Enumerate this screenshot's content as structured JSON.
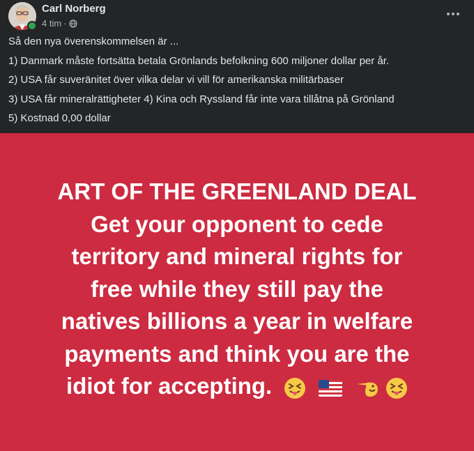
{
  "post": {
    "author": "Carl Norberg",
    "time": "4 tim",
    "separator": "·",
    "privacy_icon": "globe-icon",
    "more_icon": "more-options-icon",
    "text_lines": [
      "Så den nya överenskommelsen är ...",
      "1) Danmark måste fortsätta betala Grönlands befolkning 600 miljoner dollar per år.",
      "2) USA får suveränitet över vilka delar vi vill för amerikanska militärbaser",
      "3) USA får mineralrättigheter 4) Kina och Ryssland får inte vara tillåtna på Grönland",
      "5) Kostnad 0,00 dollar"
    ]
  },
  "card": {
    "background": "#cc2b41",
    "lines": [
      "ART OF THE GREENLAND DEAL",
      "Get your opponent to cede",
      "territory and mineral rights for",
      "free while they still pay the",
      "natives billions a year in welfare",
      "payments and think you are the",
      "idiot for accepting."
    ],
    "emojis": [
      "squinting-tongue-emoji",
      "us-flag-emoji",
      "pointing-hand-emoji",
      "squinting-tongue-emoji"
    ]
  },
  "colors": {
    "post_bg": "#242526",
    "primary_text": "#e4e6eb",
    "secondary_text": "#b0b3b8",
    "online": "#31a24c"
  }
}
